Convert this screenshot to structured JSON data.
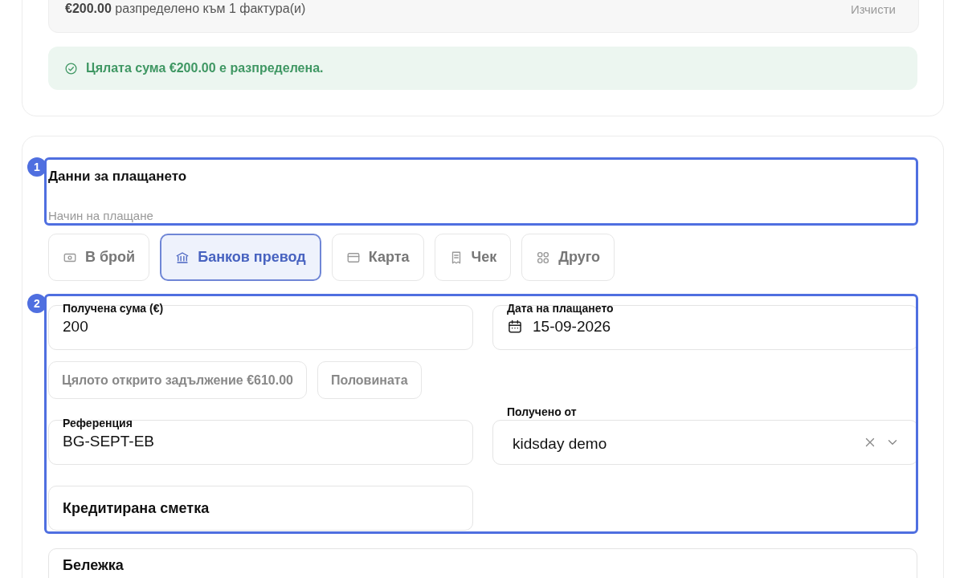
{
  "allocation_summary": {
    "amount": "€200.00",
    "text": "разпределено към 1 фактура(и)",
    "clear_button": "Изчисти"
  },
  "alert": {
    "kind": "success",
    "text": "Цялата сума €200.00 е разпределена."
  },
  "payment": {
    "title": "Данни за плащането",
    "method_label": "Начин на плащане",
    "methods": [
      {
        "label": "В брой",
        "kind": "cash",
        "selected": false
      },
      {
        "label": "Банков превод",
        "kind": "bank",
        "selected": true
      },
      {
        "label": "Карта",
        "kind": "card",
        "selected": false
      },
      {
        "label": "Чек",
        "kind": "check",
        "selected": false
      },
      {
        "label": "Друго",
        "kind": "other",
        "selected": false
      }
    ],
    "rows": [
      [
        {
          "kind": "input",
          "label": "Получена сума (€)",
          "value": "200"
        },
        {
          "kind": "date",
          "label": "Дата на плащането",
          "value": "15-09-2026"
        }
      ],
      [
        {
          "kind": "chips",
          "options": [
            "Цялото открито задължение €610.00",
            "Половината"
          ]
        }
      ],
      [
        {
          "kind": "input",
          "label": "Референция",
          "value": "BG-SEPT-EB"
        },
        {
          "kind": "select",
          "label": "Получено от",
          "value": "kidsday demo"
        }
      ],
      [
        {
          "kind": "section",
          "label": "Кредитирана сметка"
        }
      ],
      [
        {
          "kind": "textarea",
          "label": "Бележка"
        }
      ]
    ]
  },
  "annotations": [
    {
      "label": "1"
    },
    {
      "label": "2"
    }
  ]
}
